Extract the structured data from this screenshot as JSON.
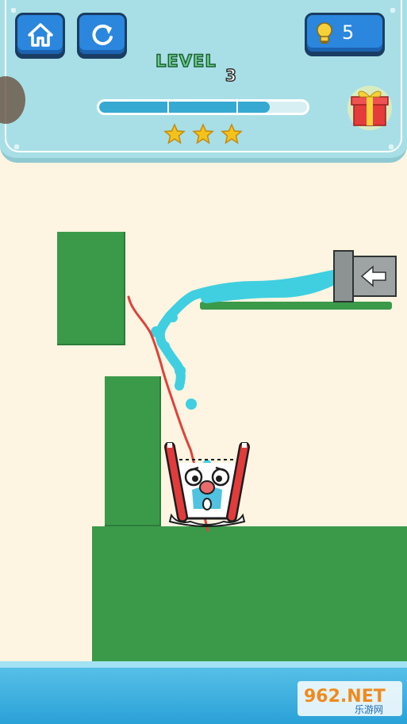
{
  "header": {
    "level_label": "LEVEL",
    "level_number": "3",
    "hint_count": "5",
    "progress_fraction": 0.82,
    "stars": 3
  },
  "watermark": {
    "text_main": "962.NET",
    "text_sub": "乐游网"
  },
  "colors": {
    "background": "#fdf5e1",
    "platform_green": "#3a9a4a",
    "water_blue": "#3fcfe0",
    "drawn_line_red": "#e0413b",
    "button_blue": "#2b86de",
    "panel_cyan": "#a8dfe6"
  },
  "icons": [
    "home-icon",
    "restart-icon",
    "lightbulb-icon",
    "star-icon",
    "gift-icon",
    "arrow-left-icon"
  ]
}
